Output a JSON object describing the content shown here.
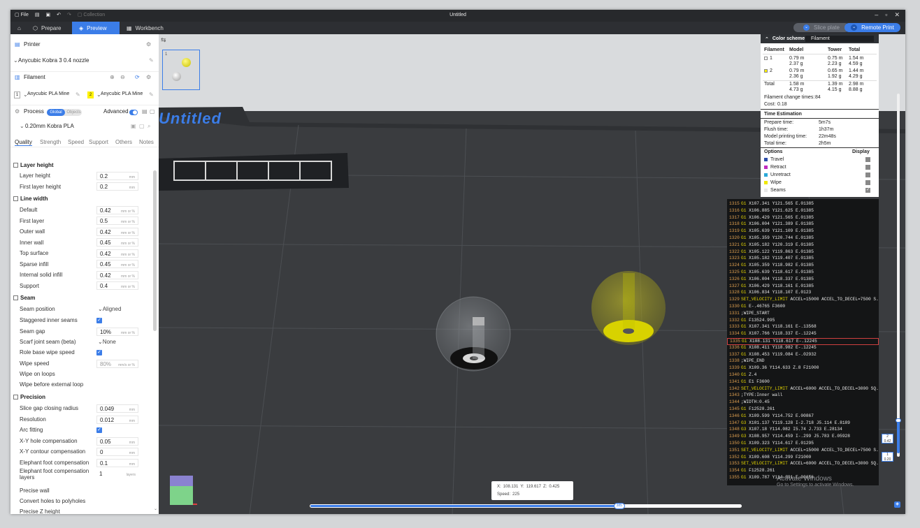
{
  "titlebar": {
    "file": "File",
    "collection": "Collection",
    "title": "Untitled"
  },
  "nav": {
    "prepare": "Prepare",
    "preview": "Preview",
    "workbench": "Workbench",
    "slice_plate": "Slice plate",
    "remote_print": "Remote Print"
  },
  "printer": {
    "section": "Printer",
    "name": "Anycubic Kobra 3 0.4 nozzle"
  },
  "filament": {
    "section": "Filament",
    "slot1": "1",
    "slot1_name": "Anycubic PLA Mine",
    "slot2": "2",
    "slot2_name": "Anycubic PLA Mine",
    "slot2_color": "#fff200"
  },
  "process": {
    "section": "Process",
    "global": "Global",
    "objects": "Objects",
    "advanced": "Advanced",
    "profile": "0.20mm Kobra PLA"
  },
  "tabs": [
    "Quality",
    "Strength",
    "Speed",
    "Support",
    "Others",
    "Notes"
  ],
  "groups": {
    "layer_height": "Layer height",
    "line_width": "Line width",
    "seam": "Seam",
    "precision": "Precision"
  },
  "layer": [
    {
      "l": "Layer height",
      "v": "0.2",
      "u": "mm"
    },
    {
      "l": "First layer height",
      "v": "0.2",
      "u": "mm"
    }
  ],
  "width": [
    {
      "l": "Default",
      "v": "0.42",
      "u": "mm or %"
    },
    {
      "l": "First layer",
      "v": "0.5",
      "u": "mm or %"
    },
    {
      "l": "Outer wall",
      "v": "0.42",
      "u": "mm or %"
    },
    {
      "l": "Inner wall",
      "v": "0.45",
      "u": "mm or %"
    },
    {
      "l": "Top surface",
      "v": "0.42",
      "u": "mm or %"
    },
    {
      "l": "Sparse infill",
      "v": "0.45",
      "u": "mm or %"
    },
    {
      "l": "Internal solid infill",
      "v": "0.42",
      "u": "mm or %"
    },
    {
      "l": "Support",
      "v": "0.4",
      "u": "mm or %"
    }
  ],
  "seam": {
    "position_l": "Seam position",
    "position_v": "Aligned",
    "staggered_l": "Staggered inner seams",
    "gap_l": "Seam gap",
    "gap_v": "10%",
    "gap_u": "mm or %",
    "scarf_l": "Scarf joint seam (beta)",
    "scarf_v": "None",
    "role_l": "Role base wipe speed",
    "wipe_speed_l": "Wipe speed",
    "wipe_speed_v": "80%",
    "wipe_speed_u": "mm/s or %",
    "wipe_loops_l": "Wipe on loops",
    "wipe_ext_l": "Wipe before external loop"
  },
  "precision": {
    "slice_gap_l": "Slice gap closing radius",
    "slice_gap_v": "0.049",
    "slice_gap_u": "mm",
    "resolution_l": "Resolution",
    "resolution_v": "0.012",
    "resolution_u": "mm",
    "arc_l": "Arc fitting",
    "xy_hole_l": "X-Y hole compensation",
    "xy_hole_v": "0.05",
    "xy_hole_u": "mm",
    "xy_contour_l": "X-Y contour compensation",
    "xy_contour_v": "0",
    "xy_contour_u": "mm",
    "elephant_l": "Elephant foot compensation",
    "elephant_v": "0.1",
    "elephant_u": "mm",
    "elephant_layers_l1": "Elephant foot compensation",
    "elephant_layers_l2": "layers",
    "elephant_layers_v": "1",
    "elephant_layers_u": "layers",
    "precise_wall_l": "Precise wall",
    "polyholes_l": "Convert holes to polyholes",
    "precise_z_l": "Precise Z height"
  },
  "plate": {
    "num": "1",
    "name": "Untitled"
  },
  "color_scheme": {
    "label": "Color scheme",
    "selected": "Filament",
    "headers": [
      "Filament",
      "Model",
      "Tower",
      "Total"
    ],
    "rows": [
      {
        "id": "1",
        "color": "#ffffff",
        "model_m": "0.79 m",
        "model_g": "2.37 g",
        "tower_m": "0.75 m",
        "tower_g": "2.23 g",
        "total_m": "1.54 m",
        "total_g": "4.59 g"
      },
      {
        "id": "2",
        "color": "#fff200",
        "model_m": "0.79 m",
        "model_g": "2.36 g",
        "tower_m": "0.65 m",
        "tower_g": "1.92 g",
        "total_m": "1.44 m",
        "total_g": "4.29 g"
      }
    ],
    "total_label": "Total",
    "total_model_m": "1.58 m",
    "total_model_g": "4.73 g",
    "total_tower_m": "1.39 m",
    "total_tower_g": "4.15 g",
    "total_m": "2.98 m",
    "total_g": "8.88 g",
    "change_times_l": "Filament change times:",
    "change_times_v": "84",
    "cost_l": "Cost:",
    "cost_v": "0.18",
    "time_est": "Time Estimation",
    "prepare_l": "Prepare time:",
    "prepare_v": "5m7s",
    "flush_l": "Flush time:",
    "flush_v": "1h37m",
    "model_l": "Model printing time:",
    "model_v": "22m48s",
    "total_time_l": "Total time:",
    "total_time_v": "2h5m",
    "options": "Options",
    "display": "Display",
    "opts": [
      {
        "name": "Travel",
        "color": "#2c4ca8"
      },
      {
        "name": "Retract",
        "color": "#c02ac0"
      },
      {
        "name": "Unretract",
        "color": "#2aa8d8"
      },
      {
        "name": "Wipe",
        "color": "#f0e800"
      },
      {
        "name": "Seams",
        "color": "#e8e8e8"
      }
    ]
  },
  "gcode": [
    {
      "n": "1315",
      "c": "G1",
      "t": " X107.341 Y121.565 E.01385"
    },
    {
      "n": "1316",
      "c": "G1",
      "t": " X106.885 Y121.625 E.01385"
    },
    {
      "n": "1317",
      "c": "G1",
      "t": " X106.429 Y121.565 E.01385"
    },
    {
      "n": "1318",
      "c": "G1",
      "t": " X106.004 Y121.389 E.01385"
    },
    {
      "n": "1319",
      "c": "G1",
      "t": " X105.639 Y121.109 E.01385"
    },
    {
      "n": "1320",
      "c": "G1",
      "t": " X105.359 Y120.744 E.01385"
    },
    {
      "n": "1321",
      "c": "G1",
      "t": " X105.182 Y120.319 E.01385"
    },
    {
      "n": "1322",
      "c": "G1",
      "t": " X105.122 Y119.863 E.01385"
    },
    {
      "n": "1323",
      "c": "G1",
      "t": " X105.182 Y119.407 E.01385"
    },
    {
      "n": "1324",
      "c": "G1",
      "t": " X105.359 Y118.982 E.01385"
    },
    {
      "n": "1325",
      "c": "G1",
      "t": " X105.639 Y118.617 E.01385"
    },
    {
      "n": "1326",
      "c": "G1",
      "t": " X106.004 Y118.337 E.01385"
    },
    {
      "n": "1327",
      "c": "G1",
      "t": " X106.429 Y118.161 E.01385"
    },
    {
      "n": "1328",
      "c": "G1",
      "t": " X106.834 Y118.107 E.0123"
    },
    {
      "n": "1329",
      "c": "SET_VELOCITY_LIMIT",
      "t": " ACCEL=15000 ACCEL_TO_DECEL=7500 S..."
    },
    {
      "n": "1330",
      "c": "G1",
      "t": " E-.46765 F3600"
    },
    {
      "n": "1331",
      "c": "",
      "t": ";WIPE_START"
    },
    {
      "n": "1332",
      "c": "G1",
      "t": " F13524.995"
    },
    {
      "n": "1333",
      "c": "G1",
      "t": " X107.341 Y118.161 E-.13568"
    },
    {
      "n": "1334",
      "c": "G1",
      "t": " X107.766 Y118.337 E-.12245"
    },
    {
      "n": "1335",
      "c": "G1",
      "t": " X108.131 Y118.617 E-.12245",
      "hl": true
    },
    {
      "n": "1336",
      "c": "G1",
      "t": " X108.411 Y118.982 E-.12245"
    },
    {
      "n": "1337",
      "c": "G1",
      "t": " X108.453 Y119.084 E-.02932"
    },
    {
      "n": "1338",
      "c": "",
      "t": ";WIPE_END"
    },
    {
      "n": "1339",
      "c": "G1",
      "t": " X109.36 Y114.633 Z.8 F21000"
    },
    {
      "n": "1340",
      "c": "G1",
      "t": " Z.4"
    },
    {
      "n": "1341",
      "c": "G1",
      "t": " E1 F3600"
    },
    {
      "n": "1342",
      "c": "SET_VELOCITY_LIMIT",
      "t": " ACCEL=6000 ACCEL_TO_DECEL=3000 SQ..."
    },
    {
      "n": "1343",
      "c": "",
      "t": ";TYPE:Inner wall"
    },
    {
      "n": "1344",
      "c": "",
      "t": ";WIDTH:0.45"
    },
    {
      "n": "1345",
      "c": "G1",
      "t": " F12528.261"
    },
    {
      "n": "1346",
      "c": "G1",
      "t": " X109.599 Y114.752 E.00867"
    },
    {
      "n": "1347",
      "c": "G3",
      "t": " X101.137 Y119.128 I-2.718 J5.114 E.8189"
    },
    {
      "n": "1348",
      "c": "G3",
      "t": " X107.18 Y114.082 I5.74 J.733 E.28134"
    },
    {
      "n": "1349",
      "c": "G3",
      "t": " X108.957 Y114.459 I-.299 J5.783 E.05928"
    },
    {
      "n": "1350",
      "c": "G1",
      "t": " X109.323 Y114.617 E.01295"
    },
    {
      "n": "1351",
      "c": "SET_VELOCITY_LIMIT",
      "t": " ACCEL=15000 ACCEL_TO_DECEL=7500 S..."
    },
    {
      "n": "1352",
      "c": "G1",
      "t": " X109.608 Y114.299 F21000"
    },
    {
      "n": "1353",
      "c": "SET_VELOCITY_LIMIT",
      "t": " ACCEL=6000 ACCEL_TO_DECEL=3000 SQ..."
    },
    {
      "n": "1354",
      "c": "G1",
      "t": " F12528.261"
    },
    {
      "n": "1355",
      "c": "G1",
      "t": " X109.787 Y114.391 E.00656"
    }
  ],
  "coords": {
    "x_l": "X:",
    "x_v": "108.131",
    "y_l": "Y:",
    "y_v": "119.617",
    "z_l": "Z:",
    "z_v": "0.425",
    "speed_l": "Speed:",
    "speed_v": "225"
  },
  "hslider": {
    "value": "385",
    "fraction": 0.71
  },
  "vslider": {
    "top_layer": "2",
    "top_z": "0.42",
    "bottom_layer": "1",
    "bottom_z": "0.20"
  },
  "watermark": {
    "line1": "Activate Windows",
    "line2": "Go to Settings to activate Windows."
  }
}
